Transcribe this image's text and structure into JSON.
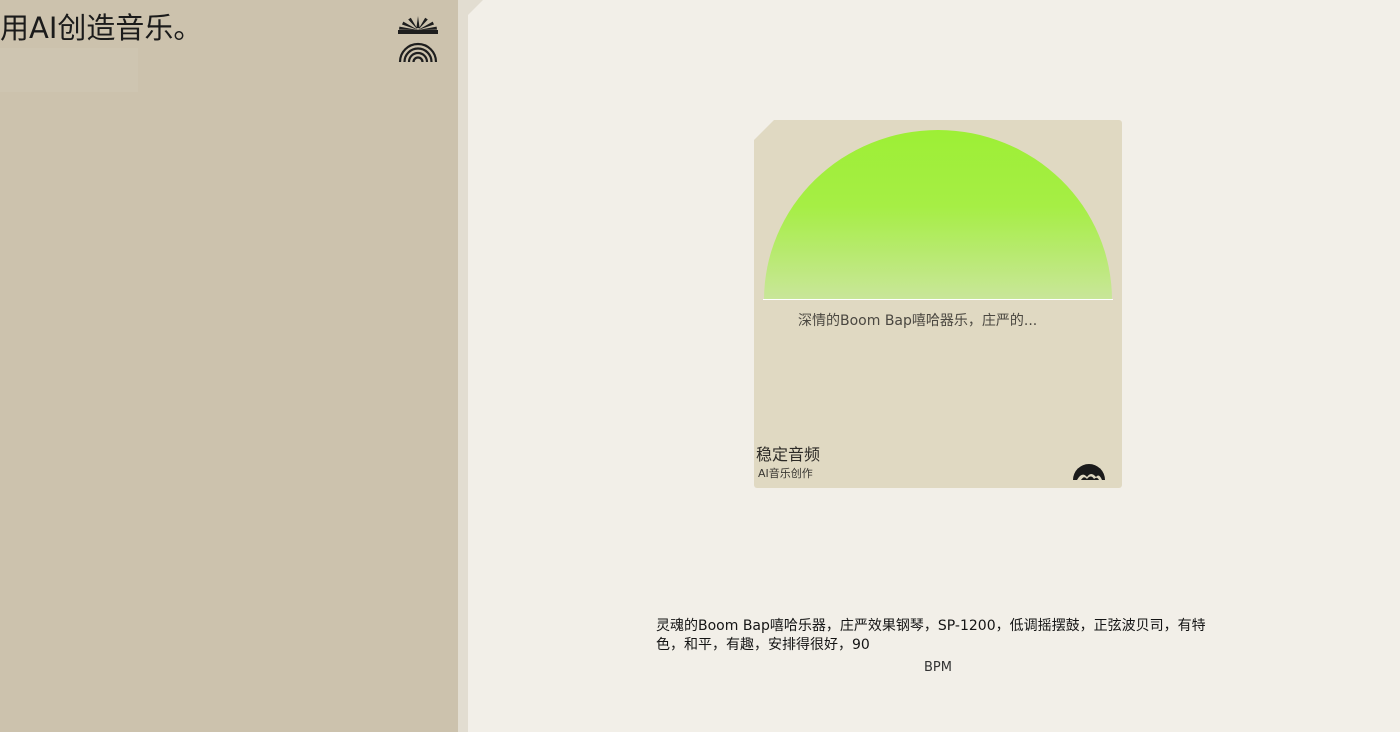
{
  "sidebar": {
    "tagline": "用AI创造音乐。",
    "logo_icon": "sunrise-rainbow-icon"
  },
  "card": {
    "description": "深情的Boom Bap嘻哈器乐，庄严的...",
    "title": "稳定音频",
    "subtitle": "AI音乐创作",
    "art_icon": "half-circle-sun-icon",
    "badge_icon": "mountain-wave-icon",
    "art_colors": {
      "top": "#9def35",
      "bottom": "#c9e69a",
      "line": "#ffffff"
    }
  },
  "prompt": {
    "text": "灵魂的Boom Bap嘻哈乐器，庄严效果钢琴，SP-1200，低调摇摆鼓，正弦波贝司，有特色，和平，有趣，安排得很好，90",
    "bpm_label": "BPM"
  },
  "colors": {
    "sidebar_bg": "#ccc2ad",
    "main_bg": "#f2efe8",
    "card_bg": "#e0d9c2"
  }
}
